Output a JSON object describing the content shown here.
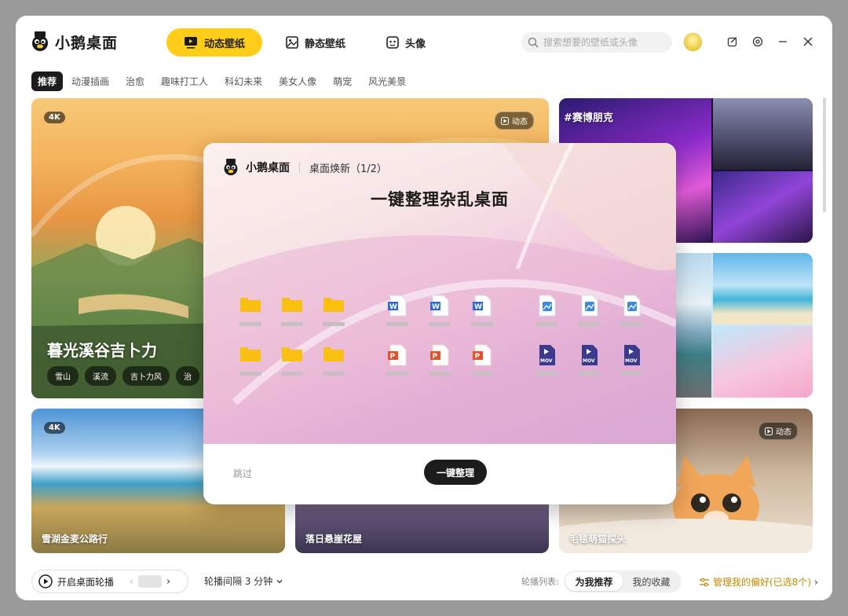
{
  "app": {
    "name": "小鹅桌面"
  },
  "main_tabs": [
    {
      "label": "动态壁纸",
      "icon": "video-play-icon",
      "active": true
    },
    {
      "label": "静态壁纸",
      "icon": "image-icon",
      "active": false
    },
    {
      "label": "头像",
      "icon": "avatar-face-icon",
      "active": false
    }
  ],
  "search": {
    "placeholder": "搜索想要的壁纸或头像"
  },
  "categories": [
    {
      "label": "推荐",
      "active": true
    },
    {
      "label": "动漫插画"
    },
    {
      "label": "治愈"
    },
    {
      "label": "趣味打工人"
    },
    {
      "label": "科幻未来"
    },
    {
      "label": "美女人像"
    },
    {
      "label": "萌宠"
    },
    {
      "label": "风光美景"
    }
  ],
  "cards": {
    "main": {
      "badge": "4K",
      "dynamic": "动态",
      "title": "暮光溪谷吉卜力",
      "tags": [
        "雪山",
        "溪流",
        "吉卜力风",
        "治"
      ]
    },
    "cyberpunk": {
      "title": "#赛博朋克"
    },
    "lake": {
      "badge": "4K",
      "title": "雪湖金麦公路行"
    },
    "cliff": {
      "title": "落日悬崖花屋"
    },
    "cat": {
      "dynamic": "动态",
      "title": "毛毯萌猫探头"
    }
  },
  "footer": {
    "carousel_toggle": "开启桌面轮播",
    "interval": "轮播间隔 3 分钟",
    "list_label": "轮播列表:",
    "list_options": [
      {
        "label": "为我推荐",
        "active": true
      },
      {
        "label": "我的收藏",
        "active": false
      }
    ],
    "preferences": "管理我的偏好(已选8个)"
  },
  "modal": {
    "brand": "小鹅桌面",
    "step": "桌面焕新（1/2）",
    "title": "一键整理杂乱桌面",
    "skip": "跳过",
    "action": "一键整理",
    "icon_groups": [
      "folder-icon",
      "word-doc-icon",
      "image-file-icon",
      "folder-icon",
      "ppt-doc-icon",
      "mov-video-icon"
    ]
  },
  "colors": {
    "accent": "#ffcc1a",
    "dark": "#1c1c1c",
    "preference": "#c28a00"
  }
}
